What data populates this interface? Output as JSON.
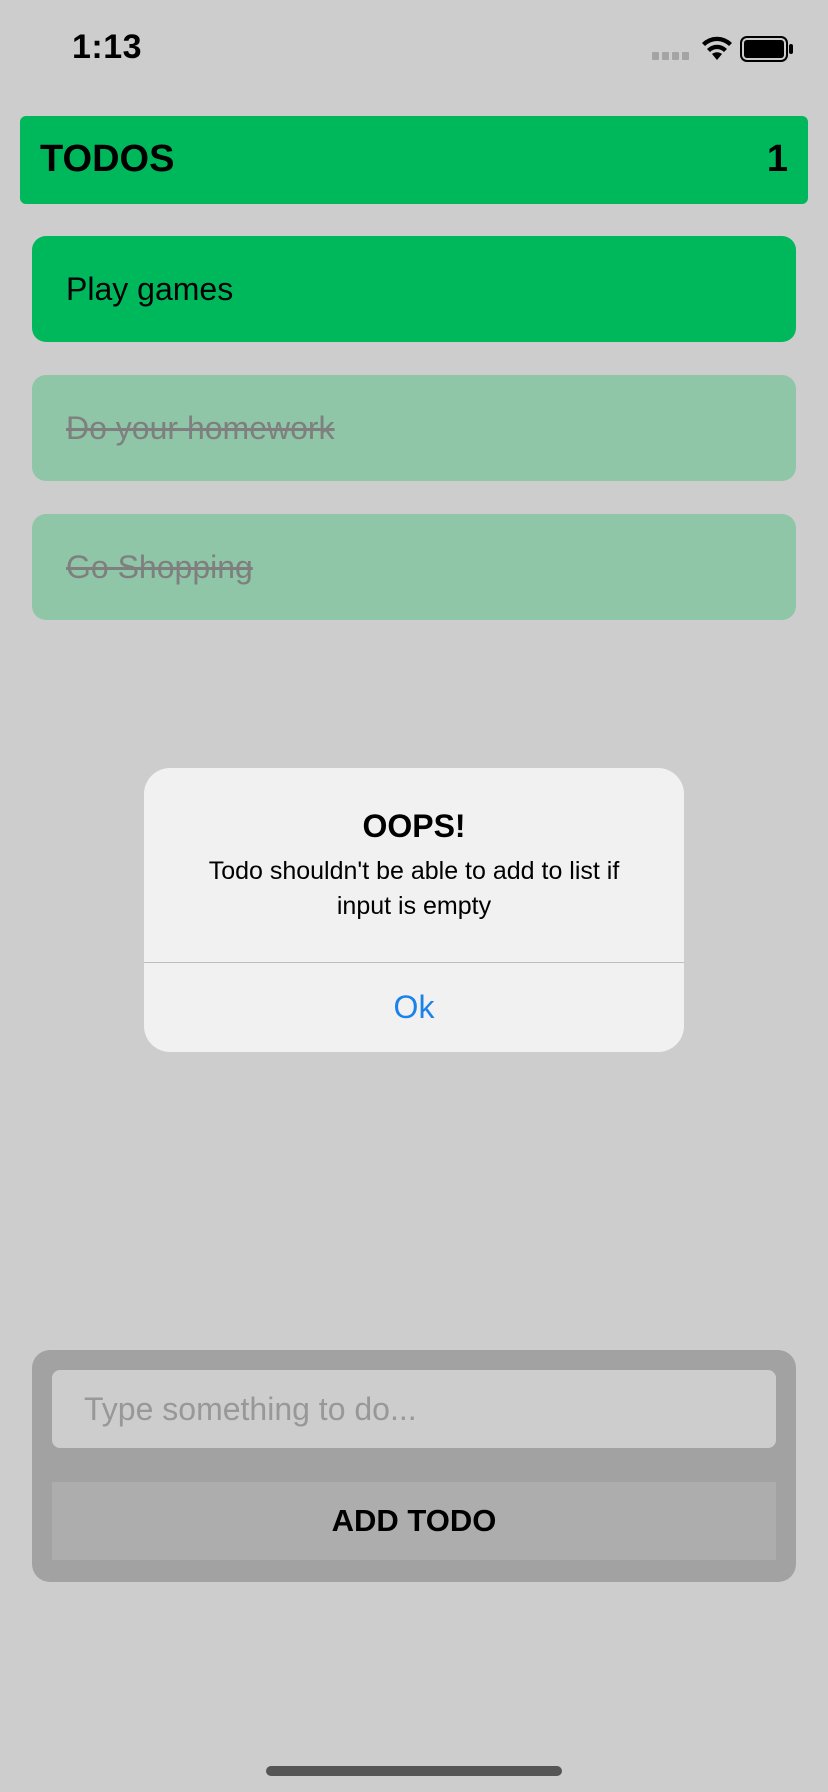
{
  "status_bar": {
    "time": "1:13",
    "icons": [
      "cellular-signal-icon",
      "wifi-icon",
      "battery-icon"
    ]
  },
  "header": {
    "title": "TODOS",
    "count": "1"
  },
  "todos": [
    {
      "text": "Play games",
      "completed": false
    },
    {
      "text": "Do your homework",
      "completed": true
    },
    {
      "text": "Go Shopping",
      "completed": true
    }
  ],
  "alert": {
    "title": "OOPS!",
    "message": "Todo shouldn't be able to add to list if input is empty",
    "ok_label": "Ok"
  },
  "input_panel": {
    "placeholder": "Type something to do...",
    "add_label": "ADD TODO"
  },
  "colors": {
    "accent_green": "#00b85c",
    "completed_green": "#8fc6a8",
    "link_blue": "#1a82ea",
    "background": "#cdcdcd"
  }
}
